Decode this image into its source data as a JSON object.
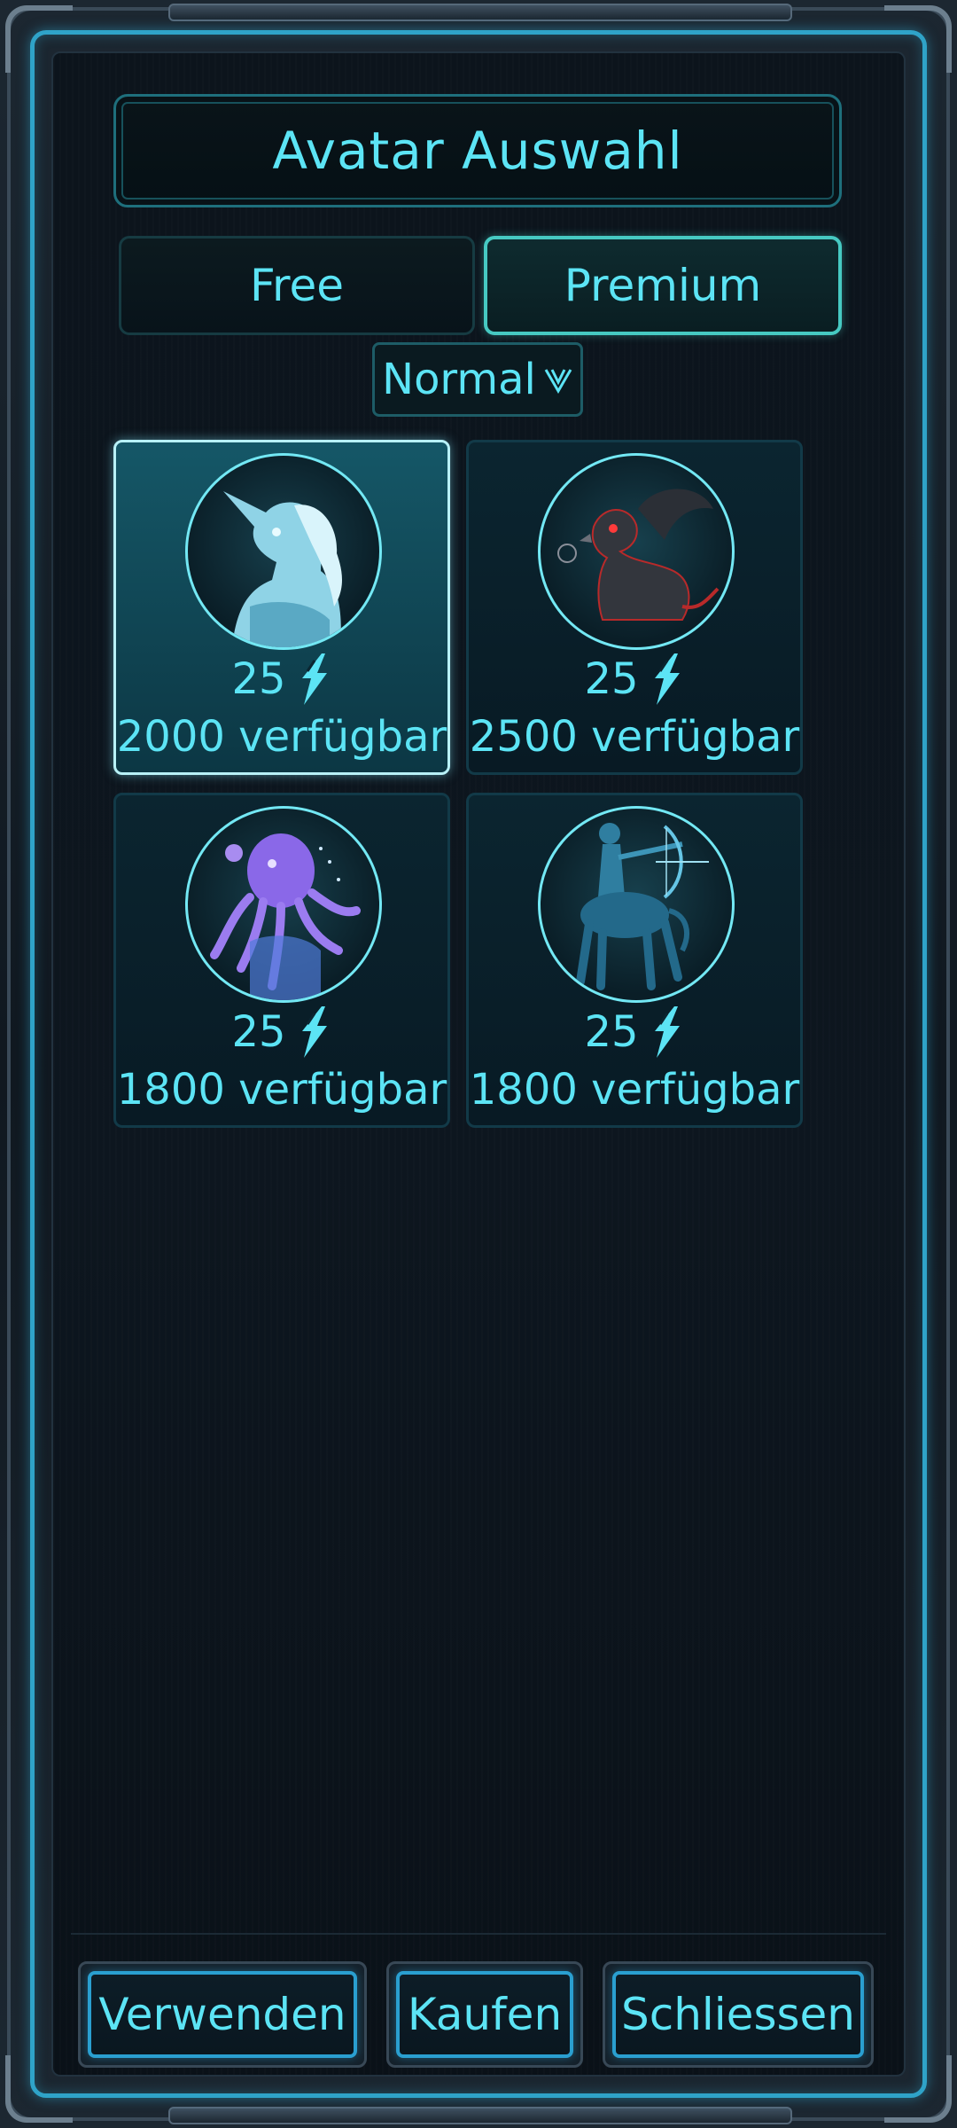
{
  "dialog": {
    "title": "Avatar Auswahl"
  },
  "tabs": [
    {
      "label": "Free",
      "active": false
    },
    {
      "label": "Premium",
      "active": true
    }
  ],
  "filter": {
    "selected": "Normal"
  },
  "avatars": [
    {
      "name": "unicorn",
      "price": "25",
      "available": "2000 verfügbar",
      "selected": true
    },
    {
      "name": "griffin",
      "price": "25",
      "available": "2500 verfügbar",
      "selected": false
    },
    {
      "name": "octopus",
      "price": "25",
      "available": "1800 verfügbar",
      "selected": false
    },
    {
      "name": "centaur",
      "price": "25",
      "available": "1800 verfügbar",
      "selected": false
    }
  ],
  "currency_icon": "gem-lightning-icon",
  "buttons": {
    "use": "Verwenden",
    "buy": "Kaufen",
    "close": "Schliessen"
  },
  "colors": {
    "accent": "#5ce4f5",
    "border_glow": "#2fa3c8",
    "selected_card": "#155767"
  }
}
